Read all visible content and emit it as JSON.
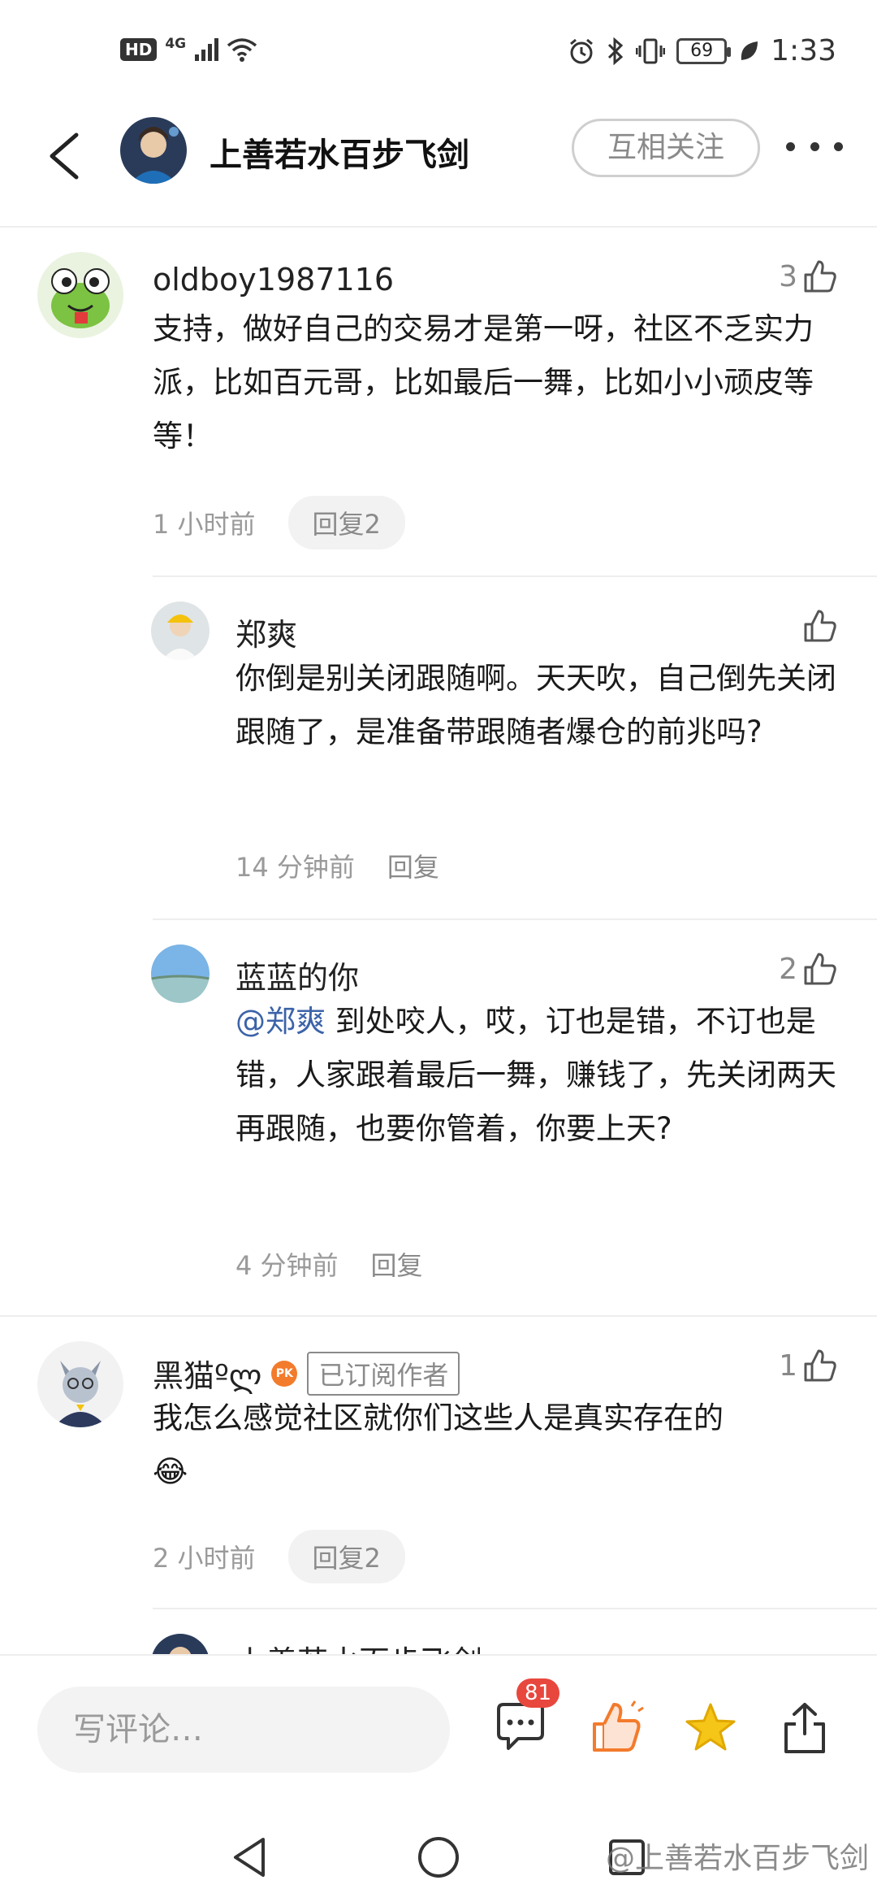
{
  "status_bar": {
    "hd": "HD",
    "network": "4G",
    "battery": "69",
    "time": "1:33"
  },
  "header": {
    "title": "上善若水百步飞剑",
    "follow_label": "互相关注"
  },
  "comments": [
    {
      "username": "oldboy1987116",
      "likes": "3",
      "text": "支持，做好自己的交易才是第一呀，社区不乏实力派，比如百元哥，比如最后一舞，比如小小顽皮等等！",
      "time": "1 小时前",
      "reply_label": "回复2"
    },
    {
      "username": "郑爽",
      "likes": "",
      "text": "你倒是别关闭跟随啊。天天吹，自己倒先关闭跟随了，是准备带跟随者爆仓的前兆吗?",
      "time": "14 分钟前",
      "reply_label": "回复"
    },
    {
      "username": "蓝蓝的你",
      "likes": "2",
      "mention": "@郑爽",
      "text": " 到处咬人，哎，订也是错，不订也是错，人家跟着最后一舞，赚钱了，先关闭两天再跟随，也要你管着，你要上天?",
      "time": "4 分钟前",
      "reply_label": "回复"
    },
    {
      "username": "黑猫ºლ",
      "badge_pk": "PK",
      "tag": "已订阅作者",
      "likes": "1",
      "text": "我怎么感觉社区就你们这些人是真实存在的",
      "emoji": "😂",
      "time": "2 小时前",
      "reply_label": "回复2"
    }
  ],
  "partial_reply": {
    "username": "上善若水百步飞剑"
  },
  "bottom_bar": {
    "input_placeholder": "写评论…",
    "comment_count": "81"
  },
  "watermark": "@上善若水百步飞剑",
  "colors": {
    "mention": "#3b63a8",
    "like_orange": "#f37b2c",
    "star": "#f5c518",
    "badge_red": "#e8473d"
  }
}
